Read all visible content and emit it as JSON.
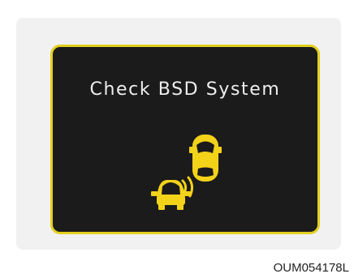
{
  "display": {
    "message": "Check BSD System",
    "frame_color": "#e3cf1f",
    "screen_color": "#1b1b1b",
    "car_color": "#f3d21a",
    "icons": [
      "front-car-icon",
      "rear-car-icon",
      "sensor-wave-icon"
    ]
  },
  "caption": "OUM054178L"
}
